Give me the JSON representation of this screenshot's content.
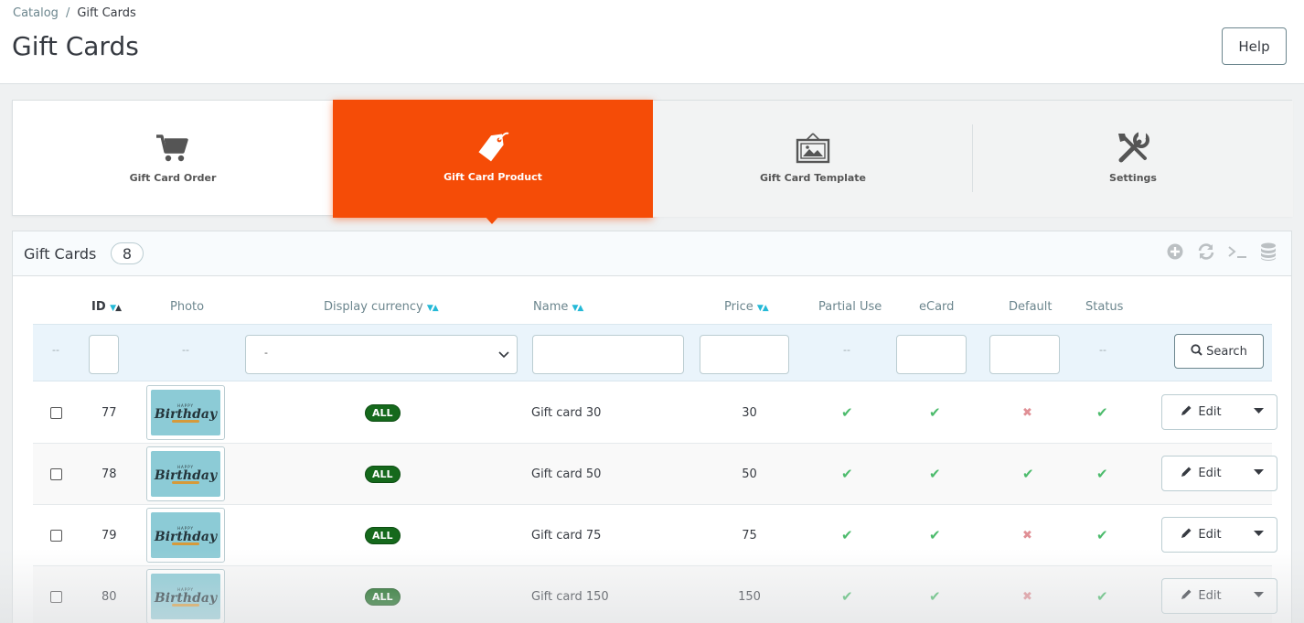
{
  "header": {
    "breadcrumb": [
      "Catalog",
      "Gift Cards"
    ],
    "breadcrumb_sep": "/",
    "title": "Gift Cards",
    "help_label": "Help"
  },
  "tabs": [
    {
      "label": "Gift Card Order",
      "icon": "cart-icon",
      "active": false
    },
    {
      "label": "Gift Card Product",
      "icon": "tag-icon",
      "active": true
    },
    {
      "label": "Gift Card Template",
      "icon": "picture-frame-icon",
      "active": false
    },
    {
      "label": "Settings",
      "icon": "tools-icon",
      "active": false
    }
  ],
  "panel": {
    "title": "Gift Cards",
    "count": "8",
    "tools": [
      "add-icon",
      "refresh-icon",
      "sql-terminal-icon",
      "database-icon"
    ]
  },
  "table": {
    "columns": {
      "id": "ID",
      "photo": "Photo",
      "currency": "Display currency",
      "name": "Name",
      "price": "Price",
      "partial": "Partial Use",
      "ecard": "eCard",
      "default": "Default",
      "status": "Status"
    },
    "filter": {
      "dash": "--",
      "currency_selected": "-",
      "search_label": "Search"
    },
    "rows": [
      {
        "id": "77",
        "currency": "ALL",
        "name": "Gift card 30",
        "price": "30",
        "partial": true,
        "ecard": true,
        "default": false,
        "status": true,
        "edit": "Edit"
      },
      {
        "id": "78",
        "currency": "ALL",
        "name": "Gift card 50",
        "price": "50",
        "partial": true,
        "ecard": true,
        "default": true,
        "status": true,
        "edit": "Edit"
      },
      {
        "id": "79",
        "currency": "ALL",
        "name": "Gift card 75",
        "price": "75",
        "partial": true,
        "ecard": true,
        "default": false,
        "status": true,
        "edit": "Edit"
      },
      {
        "id": "80",
        "currency": "ALL",
        "name": "Gift card 150",
        "price": "150",
        "partial": true,
        "ecard": true,
        "default": false,
        "status": true,
        "edit": "Edit"
      }
    ],
    "thumb": {
      "top": "HAPPY",
      "main": "Birthday"
    }
  },
  "colors": {
    "accent": "#f54c07",
    "check": "#4cbb6c",
    "cross": "#e08f95",
    "badge": "#15691c"
  }
}
